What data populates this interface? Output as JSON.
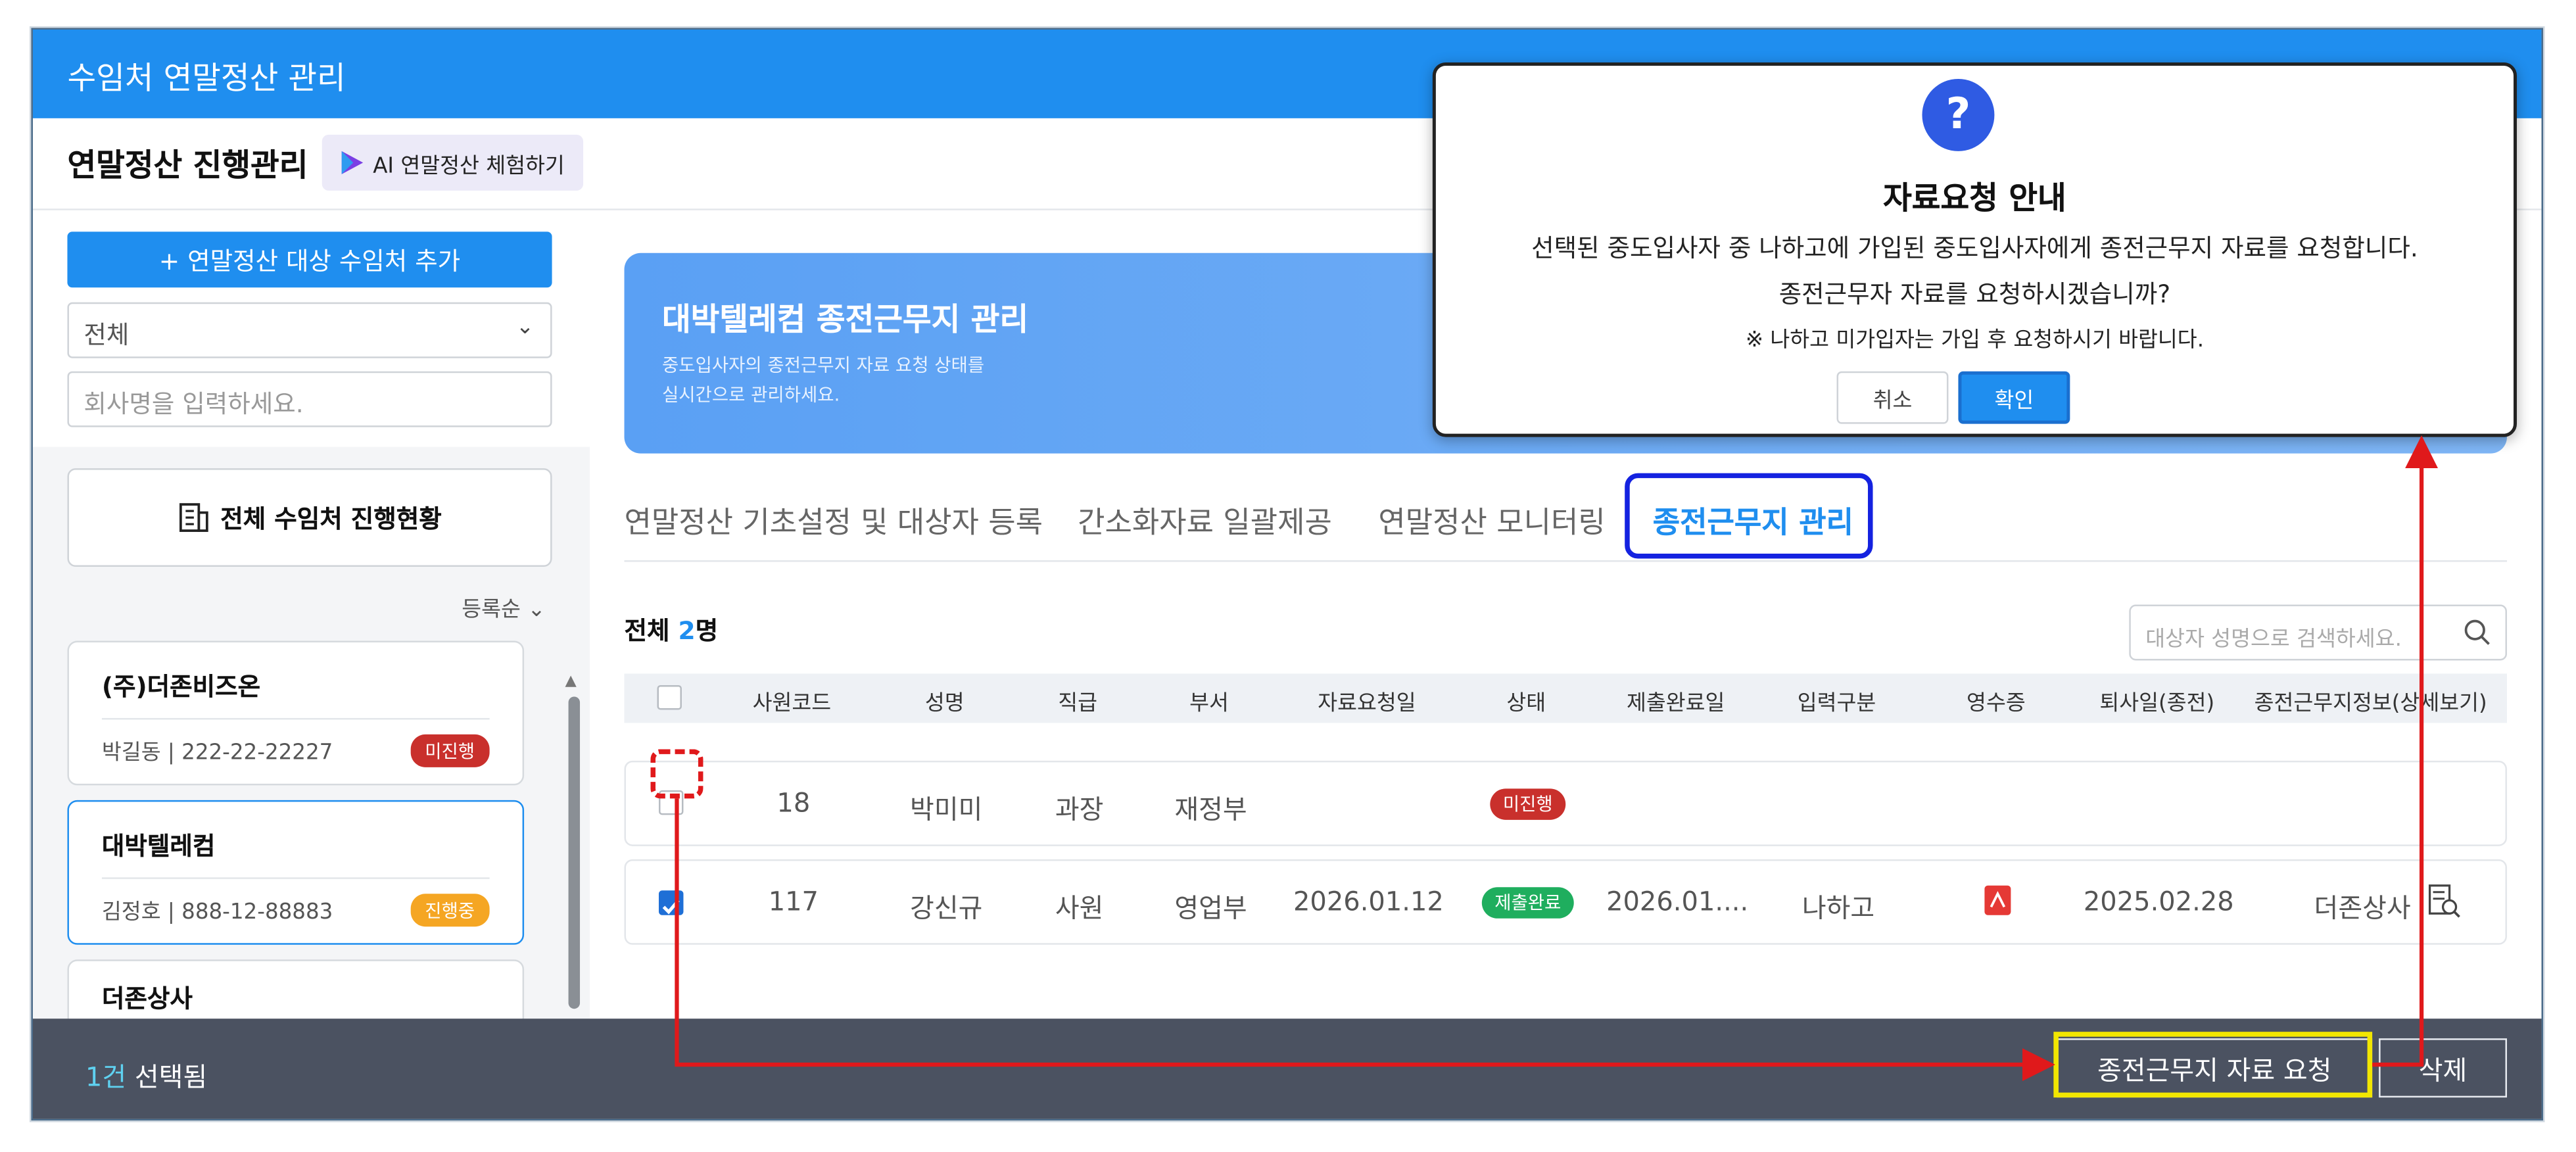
{
  "app": {
    "title": "수임처 연말정산 관리",
    "page_title": "연말정산 진행관리",
    "ai_button": "AI 연말정산 체험하기"
  },
  "sidebar": {
    "add_button": "+ 연말정산 대상 수임처 추가",
    "select_value": "전체",
    "company_placeholder": "회사명을 입력하세요.",
    "status_button": "전체 수임처 진행현황",
    "sort_label": "등록순",
    "clients": [
      {
        "name": "(주)더존비즈온",
        "info": "박길동 | 222-22-22227",
        "status": "미진행",
        "status_color": "#c9302c"
      },
      {
        "name": "대박텔레컴",
        "info": "김정호 | 888-12-88883",
        "status": "진행중",
        "status_color": "#f5a623"
      },
      {
        "name": "더존상사",
        "info": "",
        "status": "",
        "status_color": ""
      }
    ]
  },
  "banner": {
    "title": "대박텔레컴 종전근무지 관리",
    "desc_line1": "중도입사자의 종전근무지 자료 요청 상태를",
    "desc_line2": "실시간으로 관리하세요."
  },
  "tabs": [
    {
      "label": "연말정산 기초설정 및 대상자 등록",
      "active": false
    },
    {
      "label": "간소화자료 일괄제공",
      "active": false
    },
    {
      "label": "연말정산 모니터링",
      "active": false
    },
    {
      "label": "종전근무지 관리",
      "active": true
    }
  ],
  "list": {
    "count_prefix": "전체 ",
    "count_num": "2",
    "count_suffix": "명",
    "search_placeholder": "대상자 성명으로 검색하세요.",
    "columns": [
      "사원코드",
      "성명",
      "직급",
      "부서",
      "자료요청일",
      "상태",
      "제출완료일",
      "입력구분",
      "영수증",
      "퇴사일(종전)",
      "종전근무지정보(상세보기)"
    ],
    "rows": [
      {
        "checked": false,
        "code": "18",
        "name": "박미미",
        "rank": "과장",
        "dept": "재정부",
        "request_date": "",
        "status": "미진행",
        "status_color": "#c9302c",
        "submit_date": "",
        "input_type": "",
        "receipt": "",
        "leave_date": "",
        "prev_company": ""
      },
      {
        "checked": true,
        "code": "117",
        "name": "강신규",
        "rank": "사원",
        "dept": "영업부",
        "request_date": "2026.01.12",
        "status": "제출완료",
        "status_color": "#1fae5e",
        "submit_date": "2026.01....",
        "input_type": "나하고",
        "receipt": "pdf-icon",
        "leave_date": "2025.02.28",
        "prev_company": "더존상사"
      }
    ]
  },
  "bottom": {
    "selected_num": "1건",
    "selected_suffix": " 선택됨",
    "request_button": "종전근무지 자료 요청",
    "delete_button": "삭제"
  },
  "modal": {
    "icon": "?",
    "title": "자료요청 안내",
    "line1": "선택된 중도입사자 중 나하고에 가입된 중도입사자에게 종전근무지 자료를 요청합니다.",
    "line2": "종전근무자 자료를 요청하시겠습니까?",
    "note": "※ 나하고 미가입자는 가입 후 요청하시기 바랍니다.",
    "cancel": "취소",
    "ok": "확인"
  },
  "colors": {
    "brand": "#1f8eef",
    "annotation_red": "#e0191b",
    "annotation_yellow": "#f2e600",
    "annotation_blue": "#1422e0"
  }
}
